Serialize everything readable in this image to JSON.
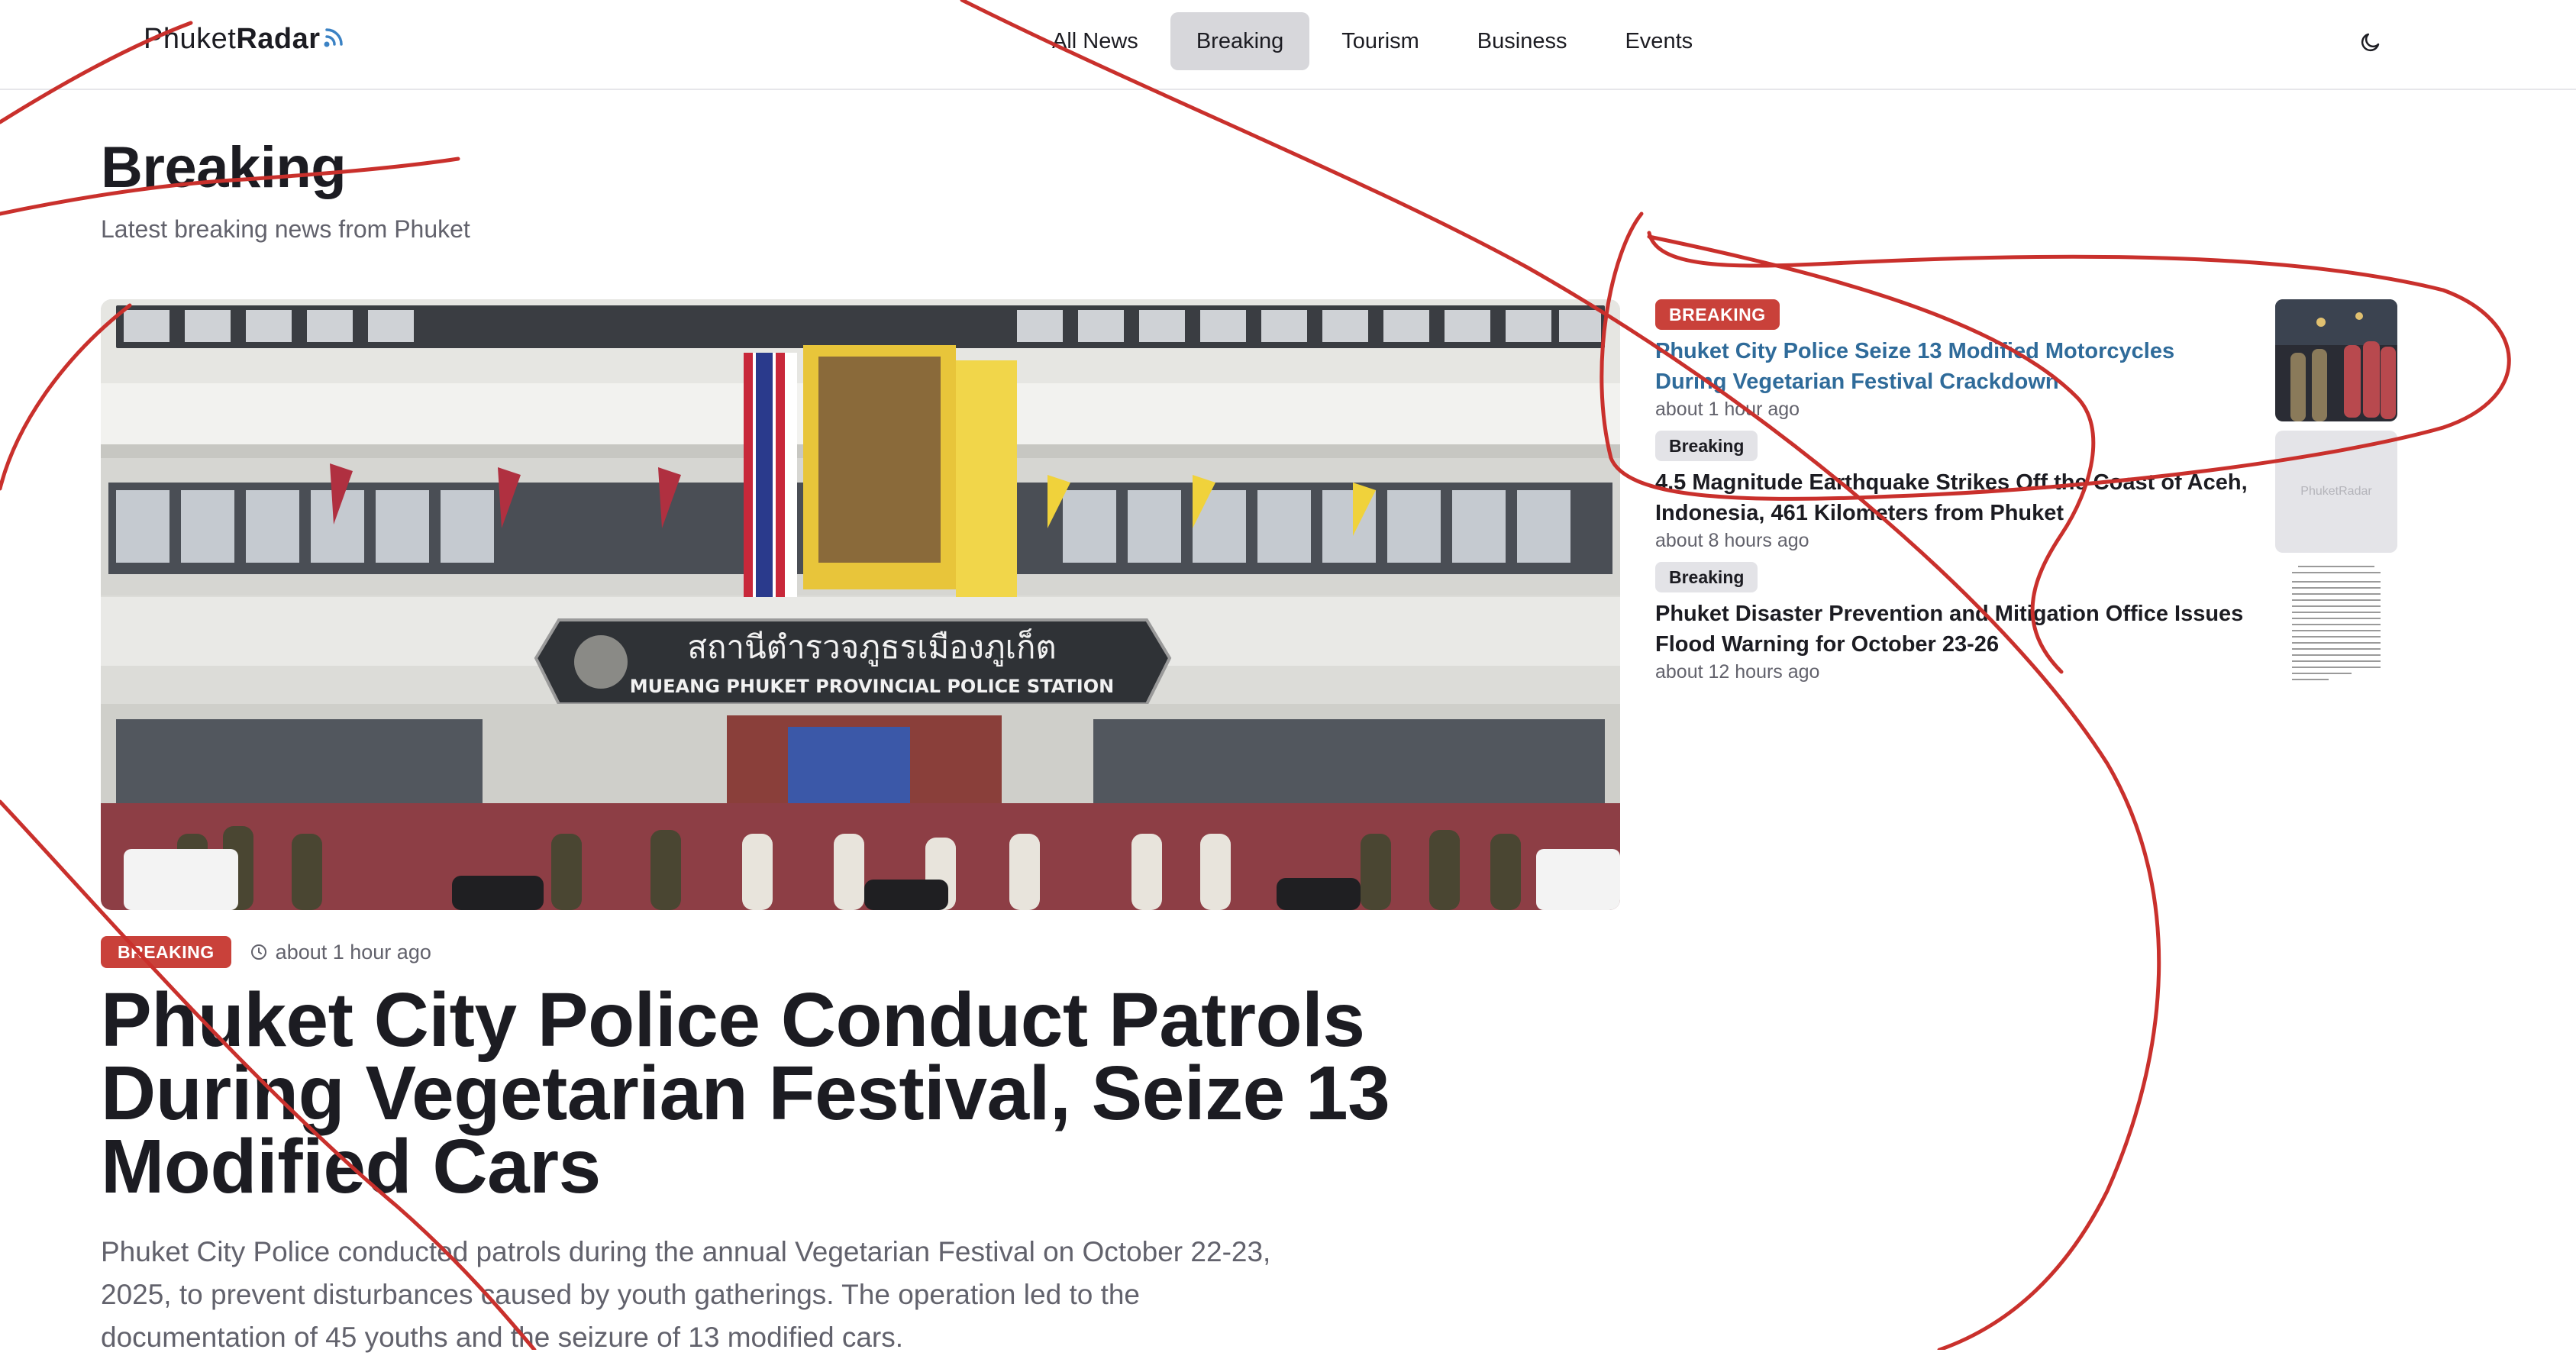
{
  "header": {
    "logo_part1": "Phuket",
    "logo_part2": "Radar",
    "nav": [
      {
        "label": "All News"
      },
      {
        "label": "Breaking"
      },
      {
        "label": "Tourism"
      },
      {
        "label": "Business"
      },
      {
        "label": "Events"
      }
    ],
    "active_nav": "Breaking",
    "theme_toggle_icon": "moon-icon"
  },
  "page": {
    "title": "Breaking",
    "subtitle": "Latest breaking news from Phuket"
  },
  "featured": {
    "badge": "BREAKING",
    "time": "about 1 hour ago",
    "title": "Phuket City Police Conduct Patrols During Vegetarian Festival, Seize 13 Modified Cars",
    "summary": "Phuket City Police conducted patrols during the annual Vegetarian Festival on October 22-23, 2025, to prevent disturbances caused by youth gatherings. The operation led to the documentation of 45 youths and the seizure of 13 modified cars.",
    "image": {
      "sign_thai": "สถานีตำรวจภูธรเมืองภูเก็ต",
      "sign_english": "MUEANG PHUKET PROVINCIAL POLICE STATION"
    }
  },
  "sidebar": {
    "items": [
      {
        "badge": "BREAKING",
        "title": "Phuket City Police Seize 13 Modified Motorcycles During Vegetarian Festival Crackdown",
        "time": "about 1 hour ago",
        "thumb": "police-night-photo"
      },
      {
        "badge": "Breaking",
        "title": "4.5 Magnitude Earthquake Strikes Off the Coast of Aceh, Indonesia, 461 Kilometers from Phuket",
        "time": "about 8 hours ago",
        "thumb_text": "PhuketRadar"
      },
      {
        "badge": "Breaking",
        "title": "Phuket Disaster Prevention and Mitigation Office Issues Flood Warning for October 23-26",
        "time": "about 12 hours ago",
        "thumb": "document-scan"
      }
    ]
  },
  "colors": {
    "accent_red": "#c9413a",
    "link_blue": "#2f6b9a",
    "active_nav_bg": "#d7d7db",
    "annotation_red": "#c9302c"
  }
}
